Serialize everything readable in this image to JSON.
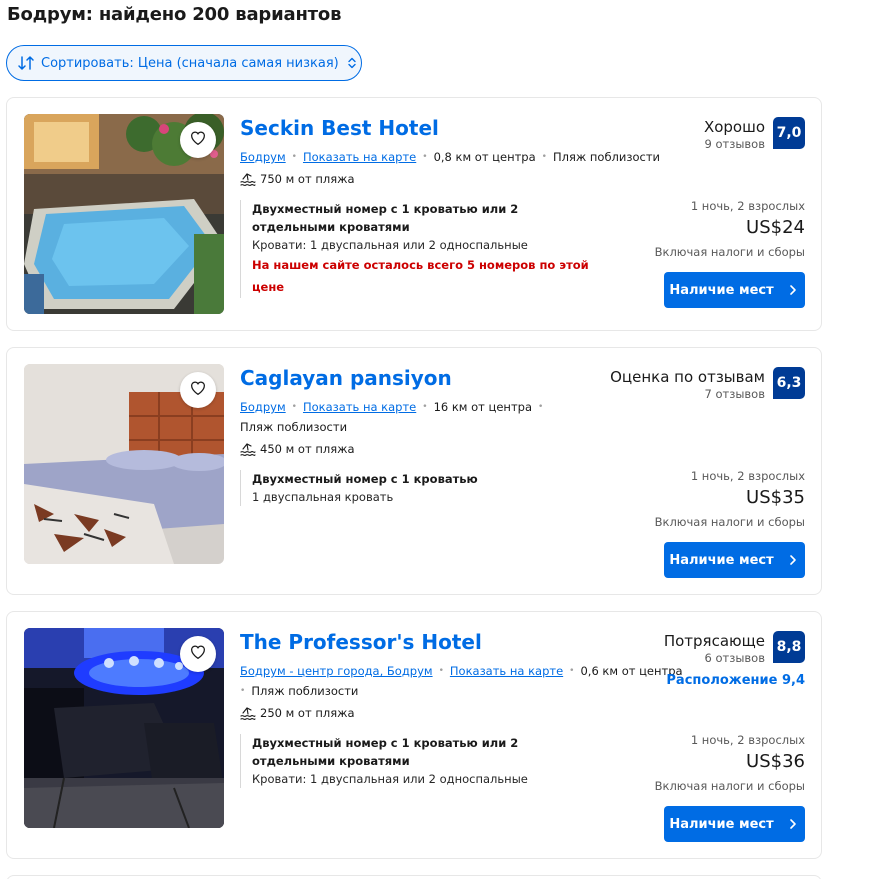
{
  "page_title": "Бодрум: найдено 200 вариантов",
  "sort": {
    "label": "Сортировать: Цена (сначала самая низкая)"
  },
  "hotels": [
    {
      "name": "Seckin Best Hotel",
      "city_link": "Бодрум",
      "map_link": "Показать на карте",
      "distance_center": "0,8 км от центра",
      "beach_nearby": "Пляж поблизости",
      "beach_distance": "750 м от пляжа",
      "room_title": "Двухместный номер с 1 кроватью или 2 отдельными кроватями",
      "beds": "Кровати: 1 двуспальная или 2 односпальные",
      "rooms_left": "На нашем сайте осталось всего 5 номеров по этой цене",
      "score_label": "Хорошо",
      "reviews": "9 отзывов",
      "score": "7,0",
      "nights": "1 ночь, 2 взрослых",
      "price": "US$24",
      "taxes": "Включая налоги и сборы",
      "button": "Наличие мест"
    },
    {
      "name": "Caglayan pansiyon",
      "city_link": "Бодрум",
      "map_link": "Показать на карте",
      "distance_center": "16 км от центра",
      "beach_nearby": "Пляж поблизости",
      "beach_distance": "450 м от пляжа",
      "room_title": "Двухместный номер с 1 кроватью",
      "beds": "1 двуспальная кровать",
      "score_label": "Оценка по отзывам",
      "reviews": "7 отзывов",
      "score": "6,3",
      "nights": "1 ночь, 2 взрослых",
      "price": "US$35",
      "taxes": "Включая налоги и сборы",
      "button": "Наличие мест"
    },
    {
      "name": "The Professor's Hotel",
      "city_link": "Бодрум - центр города, Бодрум",
      "map_link": "Показать на карте",
      "distance_center": "0,6 км от центра",
      "beach_nearby": "Пляж поблизости",
      "beach_distance": "250 м от пляжа",
      "room_title": "Двухместный номер с 1 кроватью или 2 отдельными кроватями",
      "beds": "Кровати: 1 двуспальная или 2 односпальные",
      "score_label": "Потрясающе",
      "reviews": "6 отзывов",
      "score": "8,8",
      "location_score": "Расположение 9,4",
      "nights": "1 ночь, 2 взрослых",
      "price": "US$36",
      "taxes": "Включая налоги и сборы",
      "button": "Наличие мест"
    }
  ],
  "colors": {
    "accent": "#006ce4",
    "badge": "#003b95",
    "urgent": "#cc0000"
  },
  "icons": [
    "sort-icon",
    "updown-chevron-icon",
    "heart-icon",
    "beach-wave-icon",
    "chevron-right-icon"
  ]
}
